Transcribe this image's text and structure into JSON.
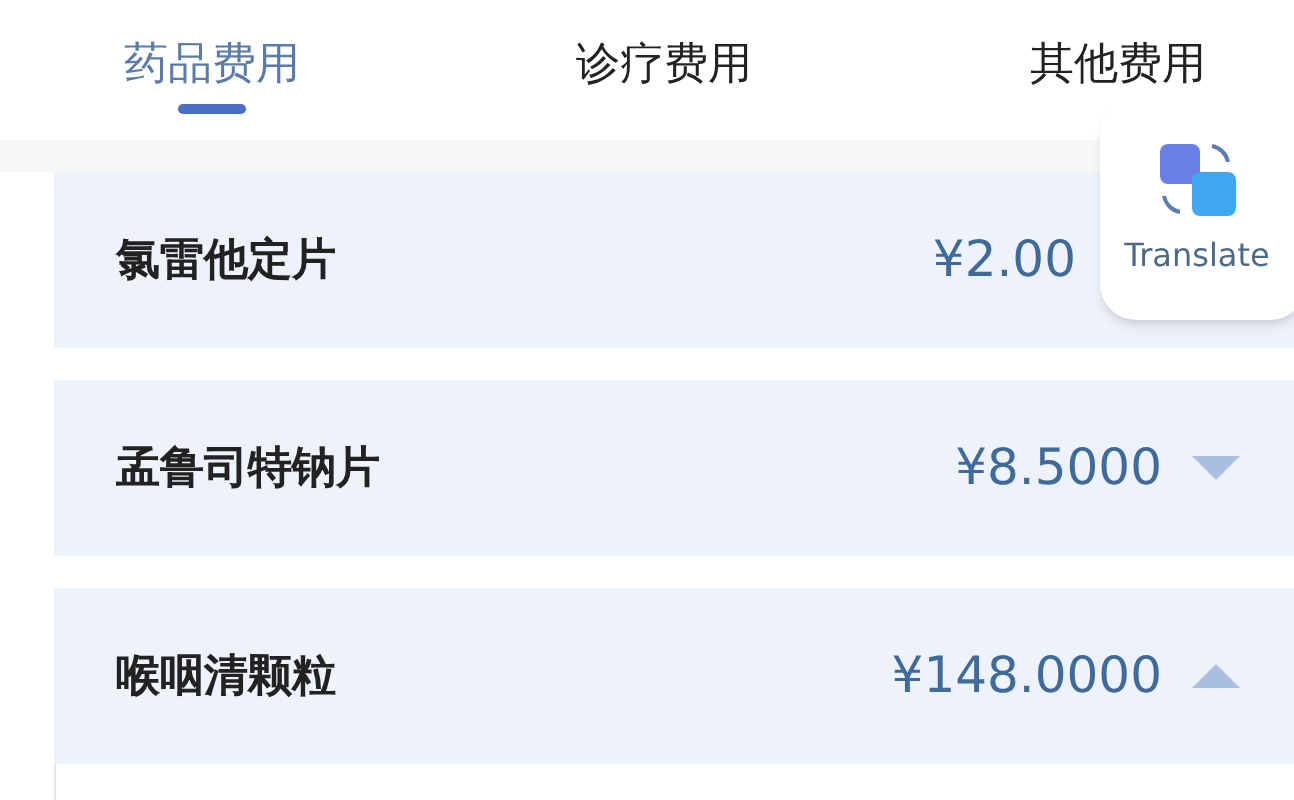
{
  "tabs": [
    {
      "label": "药品费用",
      "selected": true
    },
    {
      "label": "诊疗费用",
      "selected": false
    },
    {
      "label": "其他费用",
      "selected": false
    }
  ],
  "items": [
    {
      "name": "氯雷他定片",
      "price": "¥2.00"
    },
    {
      "name": "孟鲁司特钠片",
      "price": "¥8.5000",
      "expanded": false
    },
    {
      "name": "喉咽清颗粒",
      "price": "¥148.0000",
      "expanded": true
    }
  ],
  "translate_button": {
    "label": "Translate"
  }
}
